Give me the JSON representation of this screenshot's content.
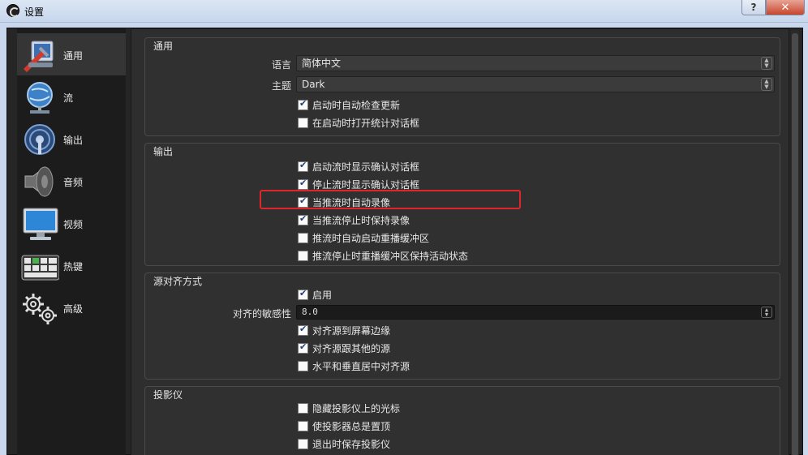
{
  "window": {
    "title": "设置",
    "help_glyph": "?",
    "close_glyph": "✕"
  },
  "sidebar": {
    "items": [
      {
        "label": "通用",
        "icon": "general-icon",
        "active": true
      },
      {
        "label": "流",
        "icon": "stream-icon",
        "active": false
      },
      {
        "label": "输出",
        "icon": "output-icon",
        "active": false
      },
      {
        "label": "音频",
        "icon": "audio-icon",
        "active": false
      },
      {
        "label": "视频",
        "icon": "video-icon",
        "active": false
      },
      {
        "label": "热键",
        "icon": "hotkeys-icon",
        "active": false
      },
      {
        "label": "高级",
        "icon": "advanced-icon",
        "active": false
      }
    ]
  },
  "general": {
    "title": "通用",
    "language_label": "语言",
    "language_value": "简体中文",
    "theme_label": "主题",
    "theme_value": "Dark",
    "check_updates": {
      "label": "启动时自动检查更新",
      "checked": true
    },
    "stats_dialog": {
      "label": "在启动时打开统计对话框",
      "checked": false
    }
  },
  "output": {
    "title": "输出",
    "items": [
      {
        "label": "启动流时显示确认对话框",
        "checked": true
      },
      {
        "label": "停止流时显示确认对话框",
        "checked": true
      },
      {
        "label": "当推流时自动录像",
        "checked": true
      },
      {
        "label": "当推流停止时保持录像",
        "checked": true
      },
      {
        "label": "推流时自动启动重播缓冲区",
        "checked": false
      },
      {
        "label": "推流停止时重播缓冲区保持活动状态",
        "checked": false
      }
    ]
  },
  "snapping": {
    "title": "源对齐方式",
    "enable": {
      "label": "启用",
      "checked": true
    },
    "sensitivity_label": "对齐的敏感性",
    "sensitivity_value": "8.0",
    "items": [
      {
        "label": "对齐源到屏幕边缘",
        "checked": true
      },
      {
        "label": "对齐源跟其他的源",
        "checked": true
      },
      {
        "label": "水平和垂直居中对齐源",
        "checked": false
      }
    ]
  },
  "projectors": {
    "title": "投影仪",
    "items": [
      {
        "label": "隐藏投影仪上的光标",
        "checked": false
      },
      {
        "label": "使投影器总是置顶",
        "checked": false
      },
      {
        "label": "退出时保存投影仪",
        "checked": false
      }
    ]
  },
  "colors": {
    "highlight": "#e0262c",
    "background": "#2e2e2e",
    "sidebar": "#1c1c1c"
  }
}
